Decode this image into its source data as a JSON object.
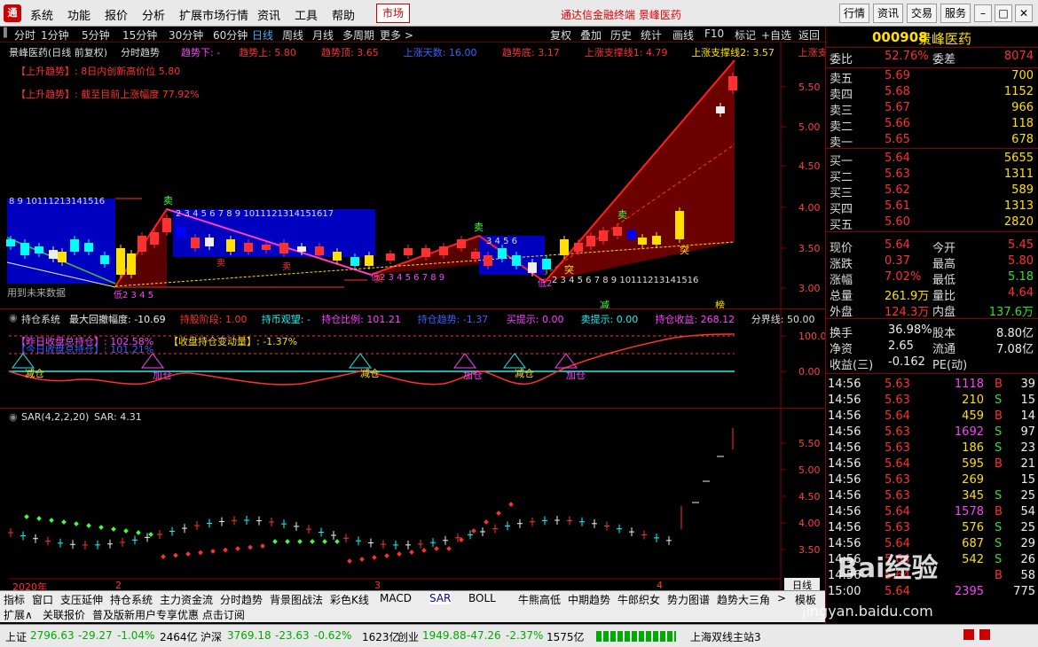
{
  "menu": {
    "items": [
      "系统",
      "功能",
      "报价",
      "分析",
      "扩展市场行情",
      "资讯",
      "工具",
      "帮助"
    ],
    "market": "市场",
    "title": "通达信金融终端  景峰医药",
    "right_buttons": [
      "行情",
      "资讯",
      "交易",
      "服务"
    ]
  },
  "toolbar": {
    "periods": [
      "分时",
      "1分钟",
      "5分钟",
      "15分钟",
      "30分钟",
      "60分钟",
      "日线",
      "周线",
      "月线",
      "多周期",
      "更多 >"
    ],
    "actions": [
      "复权",
      "叠加",
      "历史",
      "统计",
      "画线",
      "F10",
      "标记",
      "+自选",
      "返回"
    ],
    "selected": "日线"
  },
  "main": {
    "title": "景峰医药(日线 前复权)",
    "indicator": "分时趋势",
    "params": [
      {
        "label": "趋势下: -",
        "color": "#ff40ff"
      },
      {
        "label": "趋势上: 5.80",
        "color": "#ff3030"
      },
      {
        "label": "趋势顶: 3.65",
        "color": "#ff3030"
      },
      {
        "label": "上涨天数: 16.00",
        "color": "#4060ff"
      },
      {
        "label": "趋势底: 3.17",
        "color": "#ff3030"
      },
      {
        "label": "上涨支撑线1: 4.79",
        "color": "#ff3030"
      },
      {
        "label": "上涨支撑线2: 3.57",
        "color": "#ffe000"
      },
      {
        "label": "上涨支撑◇",
        "color": "#ff3030"
      }
    ],
    "notes": [
      "【上升趋势】: 8日内创新高价位 5.80",
      "【上升趋势】: 截至目前上涨幅度 77.92%"
    ],
    "future_label": "用到未来数据",
    "y_ticks": [
      "5.50",
      "5.00",
      "4.50",
      "4.00",
      "3.50",
      "3.00"
    ],
    "sell_labels": [
      "卖",
      "卖",
      "卖"
    ],
    "break_labels": [
      "突",
      "突"
    ],
    "count_labels": [
      "8 9 10111213141516",
      "2 3 4 5 6 7 8 9 1011121314151617",
      "3 4 5 6",
      "2 3 4 5 6 7 8 9 10111213141516"
    ],
    "low_labels": [
      "低2 3 4 5",
      "低2 3 4 5 6 7 8 9",
      "低2"
    ],
    "mid_labels": [
      "卖",
      "卖",
      "卖"
    ],
    "reduce": "减",
    "top_marker": "榜"
  },
  "pos": {
    "title": "持仓系统",
    "params": [
      {
        "label": "最大回撤幅度: -10.69",
        "color": "#eee"
      },
      {
        "label": "持股阶段: 1.00",
        "color": "#ff3030"
      },
      {
        "label": "持币观望: -",
        "color": "#2ee"
      },
      {
        "label": "持仓比例: 101.21",
        "color": "#ff40ff"
      },
      {
        "label": "持仓趋势: -1.37",
        "color": "#4060ff"
      },
      {
        "label": "买提示: 0.00",
        "color": "#ff40ff"
      },
      {
        "label": "卖提示: 0.00",
        "color": "#2ee"
      },
      {
        "label": "持仓收益: 268.12",
        "color": "#ff40ff"
      },
      {
        "label": "分界线: 50.00",
        "color": "#ddd"
      }
    ],
    "notes": [
      "【昨日收盘总持仓】: 102.58%",
      "【今日收盘总持仓】: 101.21%"
    ],
    "note3": "【收盘持仓变动量】: -1.37%",
    "y_ticks": [
      "100.0",
      "0.00"
    ],
    "reduce_labels": [
      "减仓",
      "加仓",
      "减仓",
      "加仓",
      "减仓",
      "加仓"
    ]
  },
  "sar": {
    "title": "SAR(4,2,2,20)",
    "value": "SAR: 4.31",
    "y_ticks": [
      "5.50",
      "5.00",
      "4.50",
      "4.00",
      "3.50"
    ],
    "x_ticks": [
      "2020年",
      "2",
      "3",
      "4"
    ],
    "period": "日线"
  },
  "quote": {
    "code": "000908",
    "name": "景峰医药",
    "weibi": {
      "l": "委比",
      "v": "52.76%",
      "l2": "委差",
      "v2": "8074"
    },
    "asks": [
      {
        "l": "卖五",
        "p": "5.69",
        "v": "700"
      },
      {
        "l": "卖四",
        "p": "5.68",
        "v": "1152"
      },
      {
        "l": "卖三",
        "p": "5.67",
        "v": "966"
      },
      {
        "l": "卖二",
        "p": "5.66",
        "v": "118"
      },
      {
        "l": "卖一",
        "p": "5.65",
        "v": "678"
      }
    ],
    "bids": [
      {
        "l": "买一",
        "p": "5.64",
        "v": "5655"
      },
      {
        "l": "买二",
        "p": "5.63",
        "v": "1311"
      },
      {
        "l": "买三",
        "p": "5.62",
        "v": "589"
      },
      {
        "l": "买四",
        "p": "5.61",
        "v": "1313"
      },
      {
        "l": "买五",
        "p": "5.60",
        "v": "2820"
      }
    ],
    "stats": [
      {
        "l": "现价",
        "v": "5.64",
        "c": "red",
        "l2": "今开",
        "v2": "5.45",
        "c2": "red"
      },
      {
        "l": "涨跌",
        "v": "0.37",
        "c": "red",
        "l2": "最高",
        "v2": "5.80",
        "c2": "red"
      },
      {
        "l": "涨幅",
        "v": "7.02%",
        "c": "red",
        "l2": "最低",
        "v2": "5.18",
        "c2": "grn"
      },
      {
        "l": "总量",
        "v": "261.9万",
        "c": "yel",
        "l2": "量比",
        "v2": "4.64",
        "c2": "red"
      },
      {
        "l": "外盘",
        "v": "124.3万",
        "c": "red",
        "l2": "内盘",
        "v2": "137.6万",
        "c2": "grn"
      }
    ],
    "stats2": [
      {
        "l": "换手",
        "v": "36.98%",
        "l2": "股本",
        "v2": "8.80亿"
      },
      {
        "l": "净资",
        "v": "2.65",
        "l2": "流通",
        "v2": "7.08亿"
      },
      {
        "l": "收益(三)",
        "v": "-0.162",
        "l2": "PE(动)",
        "v2": ""
      }
    ],
    "ticks": [
      {
        "t": "14:56",
        "p": "5.63",
        "v": "1118",
        "d": "B",
        "n": "39"
      },
      {
        "t": "14:56",
        "p": "5.63",
        "v": "210",
        "d": "S",
        "n": "15"
      },
      {
        "t": "14:56",
        "p": "5.64",
        "v": "459",
        "d": "B",
        "n": "14"
      },
      {
        "t": "14:56",
        "p": "5.63",
        "v": "1692",
        "d": "S",
        "n": "97"
      },
      {
        "t": "14:56",
        "p": "5.63",
        "v": "186",
        "d": "S",
        "n": "23"
      },
      {
        "t": "14:56",
        "p": "5.64",
        "v": "595",
        "d": "B",
        "n": "21"
      },
      {
        "t": "14:56",
        "p": "5.63",
        "v": "269",
        "d": "",
        "n": "15"
      },
      {
        "t": "14:56",
        "p": "5.63",
        "v": "345",
        "d": "S",
        "n": "25"
      },
      {
        "t": "14:56",
        "p": "5.64",
        "v": "1578",
        "d": "B",
        "n": "54"
      },
      {
        "t": "14:56",
        "p": "5.63",
        "v": "576",
        "d": "S",
        "n": "25"
      },
      {
        "t": "14:56",
        "p": "5.64",
        "v": "687",
        "d": "S",
        "n": "29"
      },
      {
        "t": "14:56",
        "p": "5.64",
        "v": "542",
        "d": "S",
        "n": "26"
      },
      {
        "t": "14:56",
        "p": "5.64",
        "v": "",
        "d": "B",
        "n": "58"
      },
      {
        "t": "15:00",
        "p": "5.64",
        "v": "2395",
        "d": "",
        "n": "775"
      }
    ]
  },
  "tabs": [
    "指标",
    "窗口",
    "支压延伸",
    "持仓系统",
    "主力资金流",
    "分时趋势",
    "背景图战法",
    "彩色K线",
    "MACD",
    "SAR",
    "BOLL",
    "牛熊高低",
    "中期趋势",
    "牛郎织女",
    "势力图谱",
    "趋势大三角",
    ">",
    "模板"
  ],
  "tabs_active": "SAR",
  "tabs2": [
    "扩展∧",
    "关联报价",
    "普及版新用户专享优惠  点击订阅"
  ],
  "status": {
    "sh": {
      "name": "上证",
      "val": "2796.63",
      "chg": "-29.27",
      "pct": "-1.04%",
      "amt": "2464亿"
    },
    "hs": {
      "name": "沪深",
      "val": "3769.18",
      "chg": "-23.63",
      "pct": "-0.62%",
      "amt": "1623亿"
    },
    "cy": {
      "name": "创业",
      "val": "1949.88",
      "chg": "-47.26",
      "pct": "-2.37%",
      "amt": "1575亿"
    },
    "server": "上海双线主站3"
  },
  "watermark": {
    "text": "Bai经验",
    "url": "jingyan.baidu.com"
  }
}
